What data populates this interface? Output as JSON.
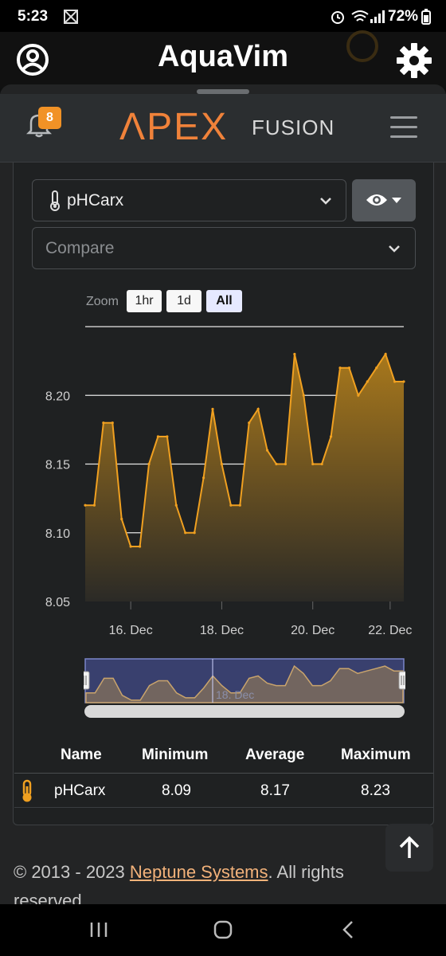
{
  "status_bar": {
    "time": "5:23",
    "battery": "72%"
  },
  "header": {
    "title": "AquaVim"
  },
  "apex": {
    "brand_main": "ΛPEX",
    "brand_sub": "FUSION",
    "notification_count": "8"
  },
  "probe_select": {
    "value": "pHCarx"
  },
  "compare_select": {
    "placeholder": "Compare"
  },
  "zoom": {
    "label": "Zoom",
    "options": [
      "1hr",
      "1d",
      "All"
    ],
    "selected": "All"
  },
  "chart_data": {
    "type": "area",
    "series": [
      {
        "name": "pHCarx",
        "x": [
          0,
          0.2,
          0.4,
          0.6,
          0.8,
          1.0,
          1.2,
          1.4,
          1.6,
          1.8,
          2.0,
          2.2,
          2.4,
          2.6,
          2.8,
          3.0,
          3.2,
          3.4,
          3.6,
          3.8,
          4.0,
          4.2,
          4.4,
          4.6,
          4.8,
          5.0,
          5.2,
          5.4,
          5.6,
          5.8,
          6.0,
          6.2,
          6.4,
          6.6,
          6.8,
          7.0
        ],
        "values": [
          8.12,
          8.12,
          8.18,
          8.18,
          8.11,
          8.09,
          8.09,
          8.15,
          8.17,
          8.17,
          8.12,
          8.1,
          8.1,
          8.14,
          8.19,
          8.15,
          8.12,
          8.12,
          8.18,
          8.19,
          8.16,
          8.15,
          8.15,
          8.23,
          8.2,
          8.15,
          8.15,
          8.17,
          8.22,
          8.22,
          8.2,
          8.21,
          8.22,
          8.23,
          8.21,
          8.21
        ]
      }
    ],
    "x_ticks": [
      "16. Dec",
      "18. Dec",
      "20. Dec",
      "22. Dec"
    ],
    "y_ticks": [
      "8.20",
      "8.15",
      "8.10",
      "8.05"
    ],
    "ylim": [
      8.05,
      8.25
    ],
    "colors": {
      "line": "#f0a020",
      "fill_top": "#a8781c",
      "fill_bottom": "#2b2a26"
    },
    "navigator_label": "18. Dec",
    "grid": true
  },
  "stats_table": {
    "headers": [
      "Name",
      "Minimum",
      "Average",
      "Maximum"
    ],
    "rows": [
      {
        "name": "pHCarx",
        "min": "8.09",
        "avg": "8.17",
        "max": "8.23"
      }
    ]
  },
  "footer": {
    "copyright": "© 2013 - 2023 ",
    "link": "Neptune Systems",
    "suffix": ". All rights reserved."
  }
}
